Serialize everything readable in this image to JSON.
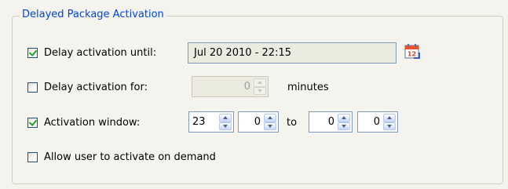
{
  "group": {
    "legend": "Delayed Package Activation"
  },
  "delay_until": {
    "checked": true,
    "label": "Delay activation until:",
    "value": "Jul 20 2010 - 22:15",
    "icon": "calendar-icon"
  },
  "delay_for": {
    "checked": false,
    "label": "Delay activation for:",
    "value": "0",
    "unit": "minutes",
    "enabled": false
  },
  "activation_window": {
    "checked": true,
    "label": "Activation window:",
    "start_hour": "23",
    "start_minute": "0",
    "to_label": "to",
    "end_hour": "0",
    "end_minute": "0"
  },
  "allow_on_demand": {
    "checked": false,
    "label": "Allow user to activate on demand"
  },
  "colors": {
    "legend": "#0046d5",
    "check": "#21a121",
    "border": "#7f9db9",
    "background": "#f4f3ee"
  }
}
